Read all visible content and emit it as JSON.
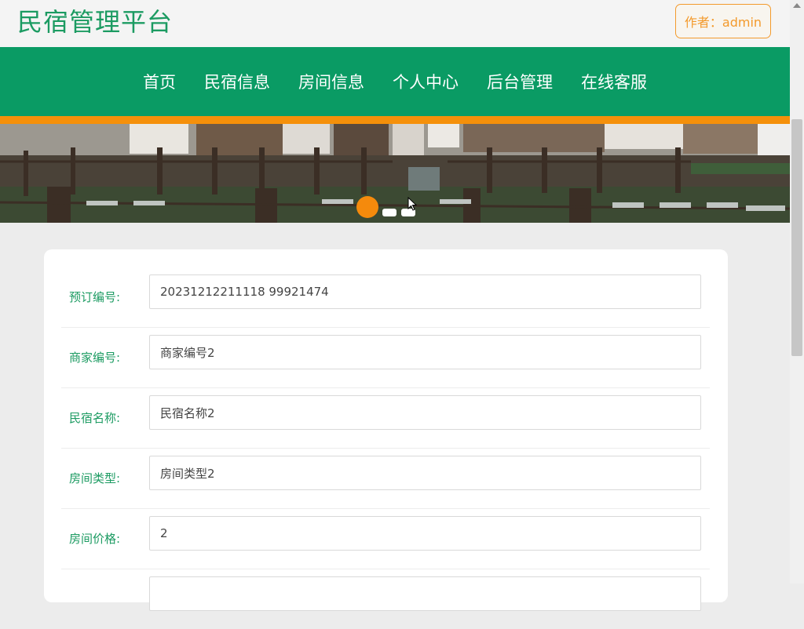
{
  "header": {
    "site_title": "民宿管理平台",
    "author_label": "作者：admin"
  },
  "nav": {
    "items": [
      "首页",
      "民宿信息",
      "房间信息",
      "个人中心",
      "后台管理",
      "在线客服"
    ]
  },
  "colors": {
    "brand_green": "#0a9b64",
    "accent_orange": "#f5900a",
    "label_green": "#1c9b62"
  },
  "form": {
    "fields": [
      {
        "label": "预订编号:",
        "value": "20231212211118 99921474"
      },
      {
        "label": "商家编号:",
        "value": "商家编号2"
      },
      {
        "label": "民宿名称:",
        "value": "民宿名称2"
      },
      {
        "label": "房间类型:",
        "value": "房间类型2"
      },
      {
        "label": "房间价格:",
        "value": "2"
      }
    ]
  }
}
